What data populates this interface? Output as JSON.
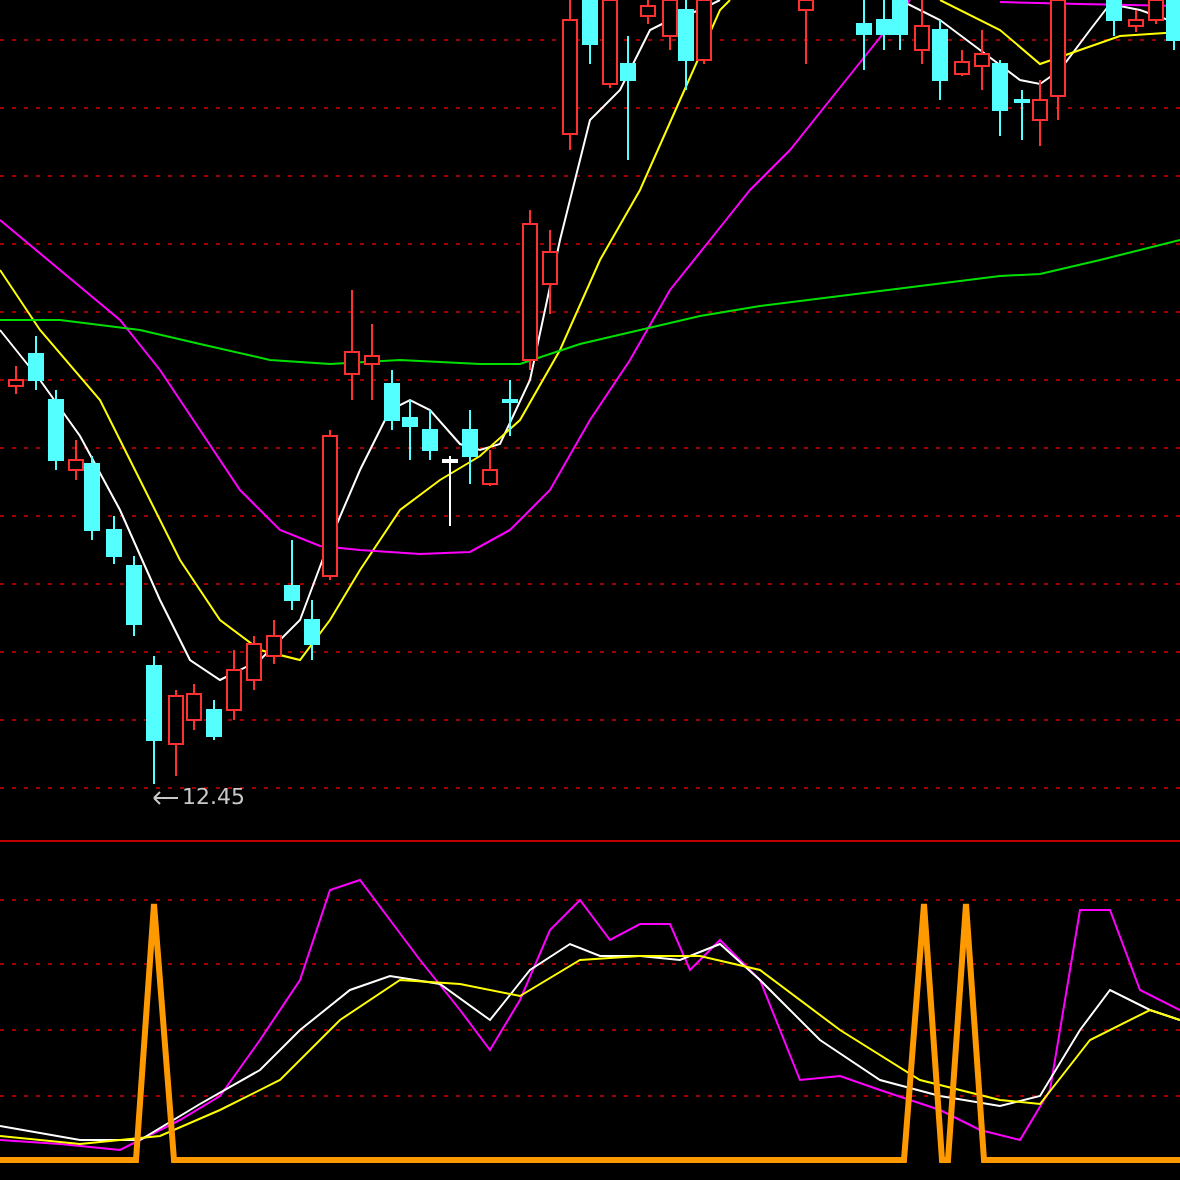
{
  "price_chart": {
    "low_marker": {
      "label": "12.45"
    }
  }
}
